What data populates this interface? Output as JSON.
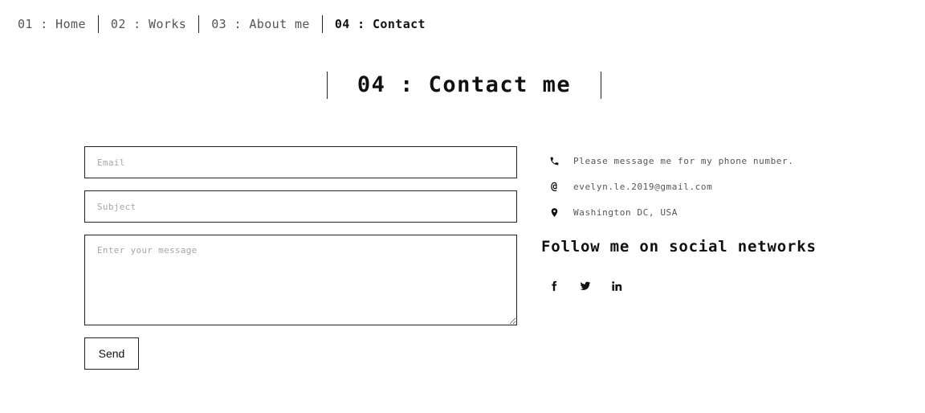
{
  "nav": {
    "items": [
      {
        "label": "01 : Home"
      },
      {
        "label": "02 : Works"
      },
      {
        "label": "03 : About me"
      },
      {
        "label": "04 : Contact"
      }
    ]
  },
  "title": "04 : Contact me",
  "form": {
    "email": {
      "placeholder": "Email",
      "value": ""
    },
    "subject": {
      "placeholder": "Subject",
      "value": ""
    },
    "message": {
      "placeholder": "Enter your message",
      "value": ""
    },
    "send_label": "Send"
  },
  "contact": {
    "phone_icon": "phone-icon",
    "phone": "Please message me for my phone number.",
    "email_icon": "at-icon",
    "email": "evelyn.le.2019@gmail.com",
    "location_icon": "map-pin-icon",
    "location": "Washington DC, USA"
  },
  "follow_title": "Follow me on social networks",
  "social": [
    {
      "icon": "facebook-icon"
    },
    {
      "icon": "twitter-icon"
    },
    {
      "icon": "linkedin-icon"
    }
  ],
  "colors": {
    "background": "#ffffff",
    "text": "#111111",
    "muted": "#555555",
    "border": "#222222"
  }
}
